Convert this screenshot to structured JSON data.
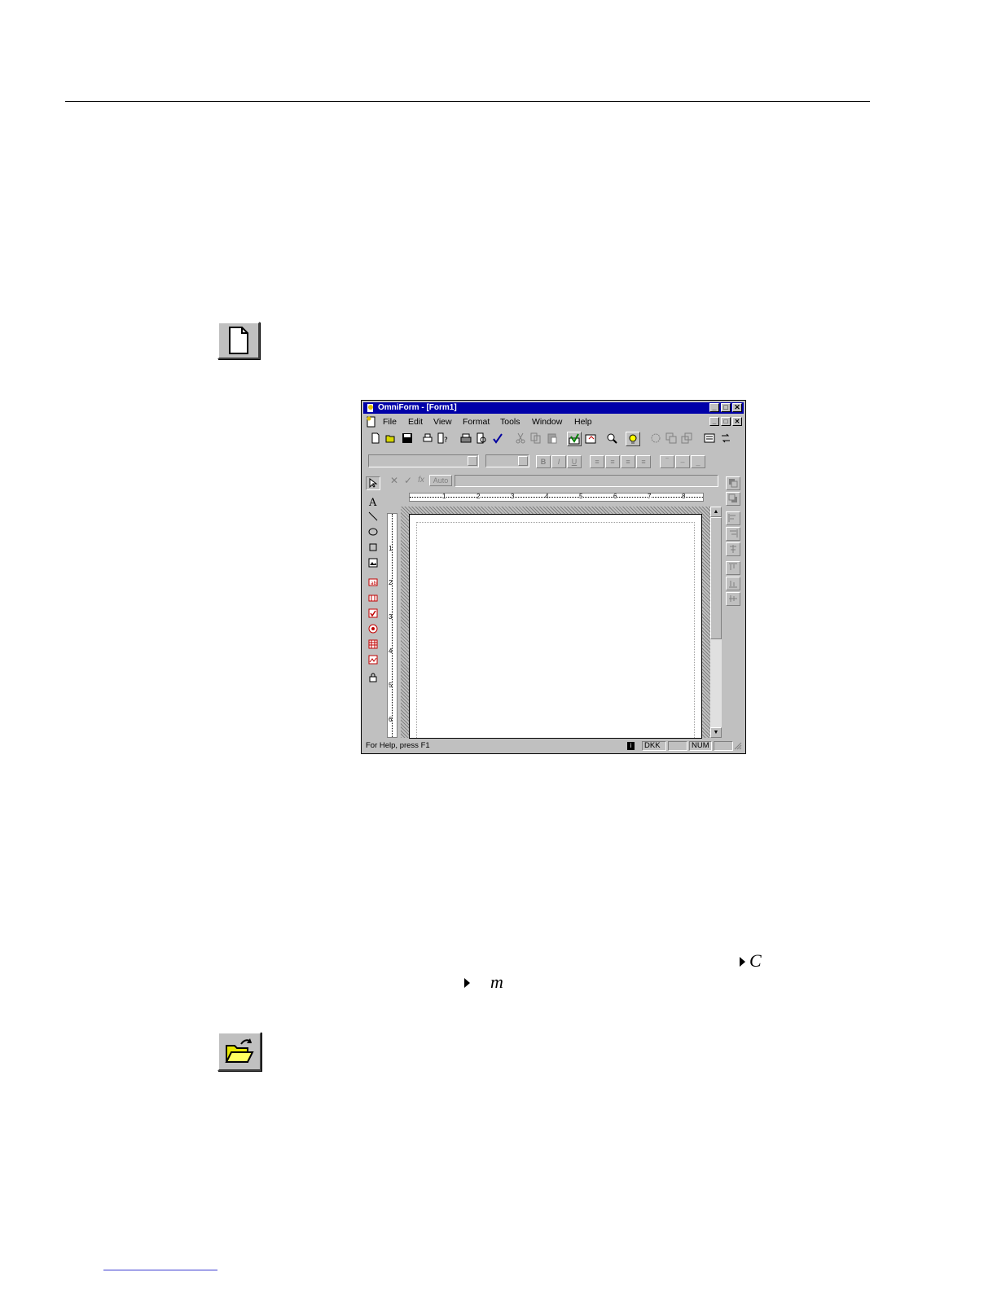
{
  "window": {
    "title": "OmniForm - [Form1]",
    "min_glyph": "_",
    "max_glyph": "□",
    "close_glyph": "✕",
    "menu": [
      "File",
      "Edit",
      "View",
      "Format",
      "Tools",
      "Window",
      "Help"
    ],
    "formula_bar": {
      "auto_label": "Auto"
    },
    "ruler_numbers": [
      "1",
      "2",
      "3",
      "4",
      "5",
      "6",
      "7",
      "8"
    ],
    "vertical_ruler_numbers": [
      "1",
      "2",
      "3",
      "4",
      "5",
      "6"
    ],
    "format_buttons": [
      "B",
      "I",
      "U"
    ],
    "status": {
      "help_text": "For Help, press F1",
      "panel_dkk": "DKK",
      "panel_num": "NUM"
    }
  },
  "page_text": {
    "fragment_c": "C",
    "fragment_m": "m"
  },
  "icons": {
    "new_document": "new-document-icon",
    "open_folder": "open-folder-icon"
  },
  "colors": {
    "title_bar": "#0000a8",
    "chrome": "#c0c0c0",
    "folder_yellow": "#e8e800"
  }
}
